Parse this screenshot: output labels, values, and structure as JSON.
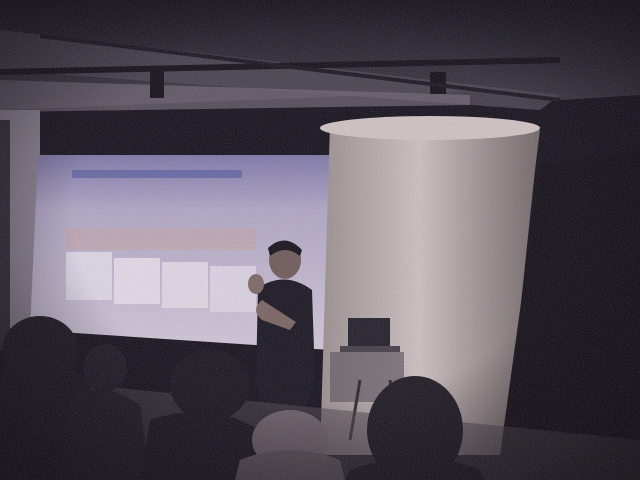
{
  "scene": {
    "description_label": "",
    "colors": {
      "background": "#0c0c0e",
      "ceiling": "#2a2a2e",
      "screen": "#c9c4d6",
      "screen_header": "#8f8bb8",
      "slide_cards": "#e7e1ea",
      "pillar": "#bdb3ad",
      "presenter_shirt": "#111116",
      "audience": "#141316",
      "laptop": "#1b1b20"
    },
    "icons": {
      "presenter": "person-silhouette",
      "audience": "person-silhouette",
      "projector_screen": "projection-screen",
      "laptop": "laptop-icon"
    }
  }
}
